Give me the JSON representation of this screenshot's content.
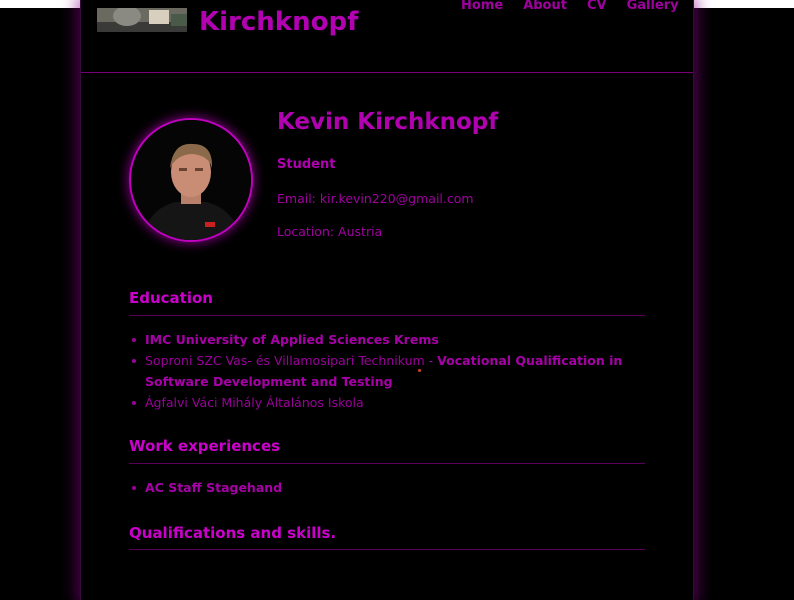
{
  "header": {
    "name": "Kirchknopf",
    "nav": [
      "Home",
      "About",
      "CV",
      "Gallery"
    ]
  },
  "profile": {
    "name": "Kevin Kirchknopf",
    "role": "Student",
    "email": "Email: kir.kevin220@gmail.com",
    "location": "Location: Austria"
  },
  "education": {
    "title": "Education",
    "items": [
      {
        "bold": "IMC University of Applied Sciences Krems",
        "plain": ""
      },
      {
        "plain": "Soproni SZC Vas- és Villamosipari Technikum - ",
        "bold": "Vocational Qualification in Software Development and Testing"
      },
      {
        "plain": "Ágfalvi Váci Mihály Általános Iskola",
        "bold": ""
      }
    ]
  },
  "work": {
    "title": "Work experiences",
    "items": [
      {
        "bold": "AC Staff Stagehand",
        "plain": ""
      }
    ]
  },
  "skills": {
    "title": "Qualifications and skills."
  },
  "colors": {
    "accent": "#b000b0",
    "background": "#000000",
    "glow": "#8c008c"
  }
}
